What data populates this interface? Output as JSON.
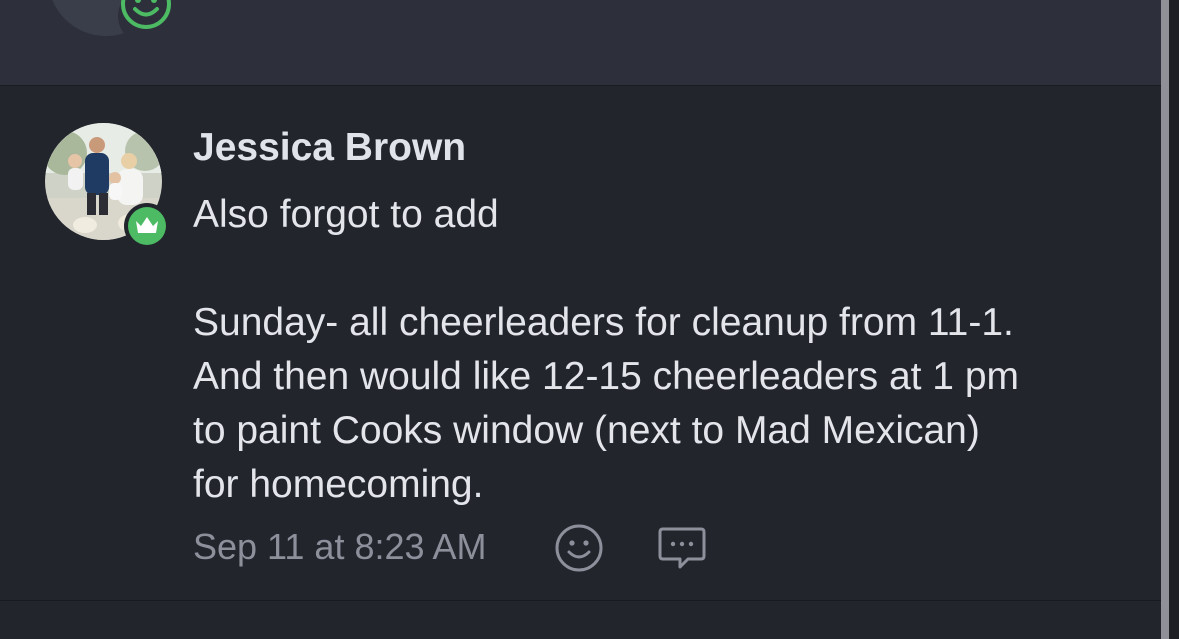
{
  "previous_message": {
    "reaction_icon": "smiley-face-icon"
  },
  "message": {
    "author": "Jessica Brown",
    "author_role_icon": "crown-icon",
    "lines": [
      "Also forgot to add",
      "",
      "Sunday- all cheerleaders for cleanup from 11-1.",
      "And then would like 12-15 cheerleaders at 1 pm",
      "to paint Cooks window (next to Mad Mexican)",
      "for homecoming."
    ],
    "timestamp": "Sep 11 at 8:23 AM",
    "actions": {
      "react_icon": "smiley-face-icon",
      "reply_icon": "chat-bubble-icon"
    }
  },
  "colors": {
    "background": "#23252d",
    "previous_message_background": "#2d303b",
    "accent_green": "#4cbb63",
    "text_primary": "#e3e5eb",
    "text_muted": "#8d909b"
  }
}
